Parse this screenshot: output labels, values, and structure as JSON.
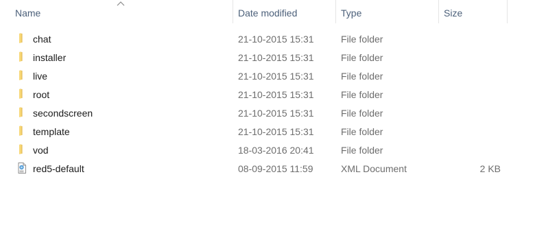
{
  "columns": {
    "name": "Name",
    "date": "Date modified",
    "type": "Type",
    "size": "Size",
    "sort_indicator": "sort-ascending-arrow"
  },
  "colors": {
    "header_text": "#4c607a",
    "name_text": "#1a1a1a",
    "detail_text": "#6d6d6d",
    "folder_icon": "#f8d775"
  },
  "files": [
    {
      "name": "chat",
      "date": "21-10-2015 15:31",
      "type": "File folder",
      "size": "",
      "icon": "folder-icon"
    },
    {
      "name": "installer",
      "date": "21-10-2015 15:31",
      "type": "File folder",
      "size": "",
      "icon": "folder-icon"
    },
    {
      "name": "live",
      "date": "21-10-2015 15:31",
      "type": "File folder",
      "size": "",
      "icon": "folder-icon"
    },
    {
      "name": "root",
      "date": "21-10-2015 15:31",
      "type": "File folder",
      "size": "",
      "icon": "folder-icon"
    },
    {
      "name": "secondscreen",
      "date": "21-10-2015 15:31",
      "type": "File folder",
      "size": "",
      "icon": "folder-icon"
    },
    {
      "name": "template",
      "date": "21-10-2015 15:31",
      "type": "File folder",
      "size": "",
      "icon": "folder-icon"
    },
    {
      "name": "vod",
      "date": "18-03-2016 20:41",
      "type": "File folder",
      "size": "",
      "icon": "folder-icon"
    },
    {
      "name": "red5-default",
      "date": "08-09-2015 11:59",
      "type": "XML Document",
      "size": "2 KB",
      "icon": "xml-document-icon"
    }
  ]
}
